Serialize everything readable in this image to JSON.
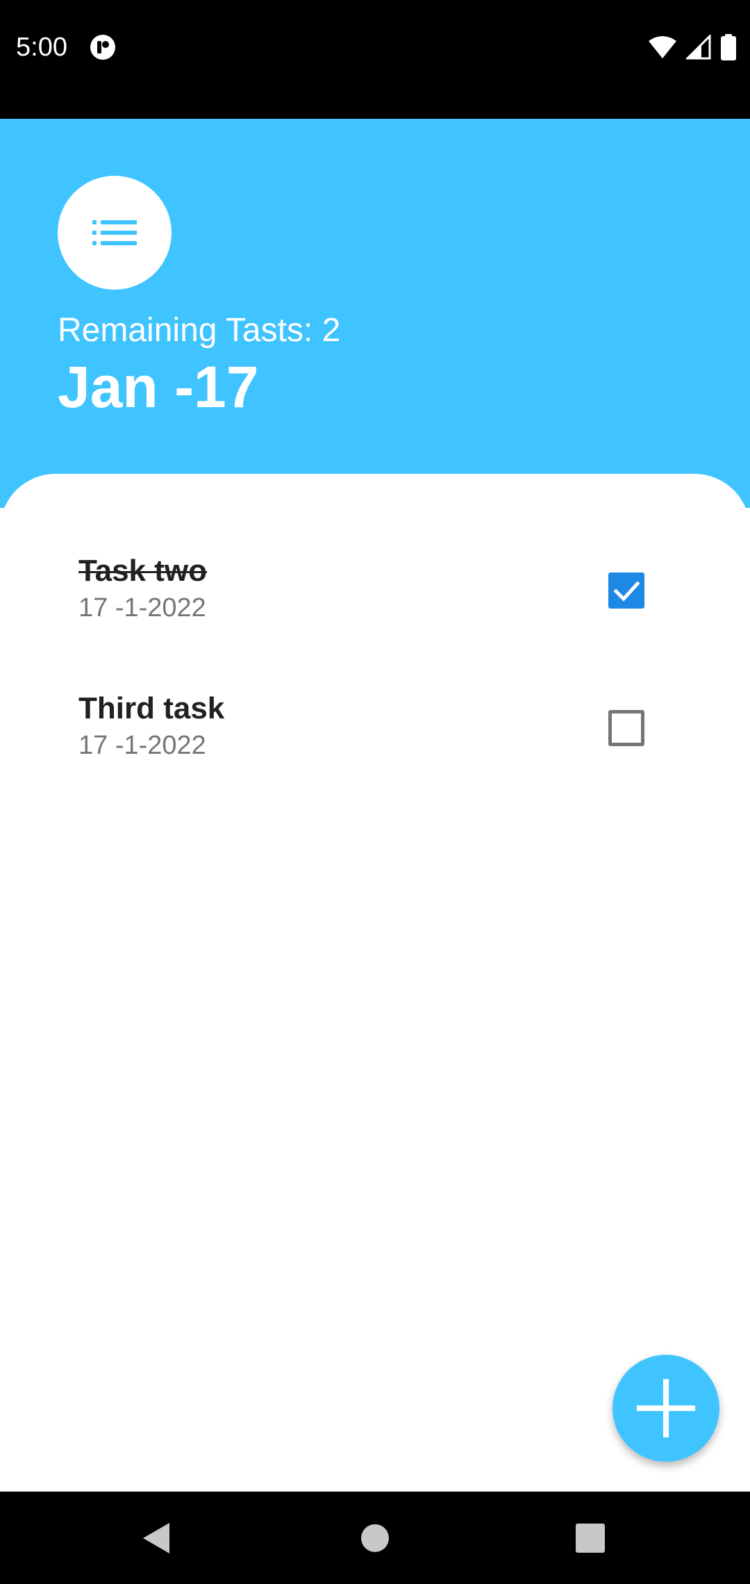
{
  "status_bar": {
    "time": "5:00",
    "icons": [
      "app-notification-icon",
      "wifi-icon",
      "cellular-signal-icon",
      "battery-icon"
    ]
  },
  "header": {
    "icon": "list-icon",
    "remaining_text": "Remaining Tasts: 2",
    "date_title": "Jan -17",
    "background_color": "#40c4ff"
  },
  "tasks": [
    {
      "title": "Task two",
      "date": "17 -1-2022",
      "completed": true
    },
    {
      "title": "Third task",
      "date": "17 -1-2022",
      "completed": false
    }
  ],
  "fab": {
    "icon": "plus-icon",
    "color": "#40c4ff"
  },
  "nav_bar": {
    "buttons": [
      "back-icon",
      "home-icon",
      "recents-icon"
    ]
  },
  "colors": {
    "accent": "#40c4ff",
    "checkbox_checked": "#1e88e5",
    "text_primary": "#212121",
    "text_secondary": "#757575"
  }
}
